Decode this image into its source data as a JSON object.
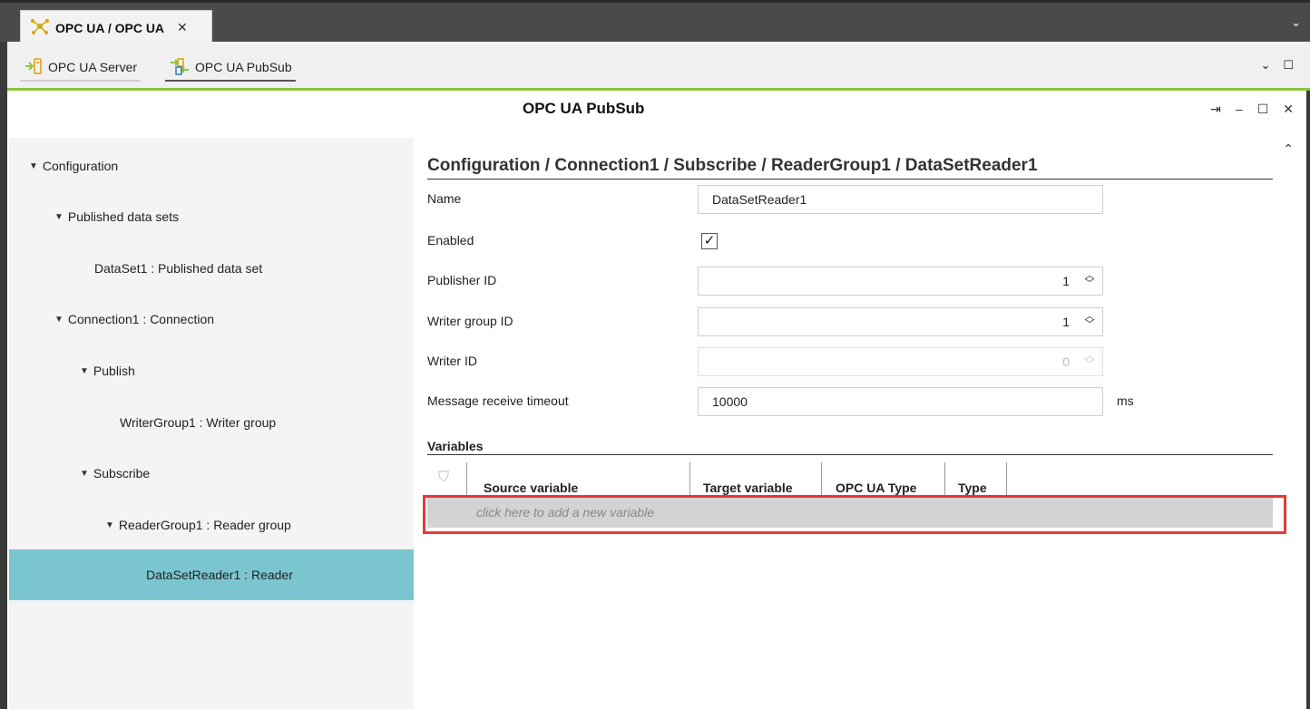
{
  "tab": {
    "label": "OPC UA / OPC UA",
    "close": "✕"
  },
  "tabbar": {
    "menu_glyph": "⌄"
  },
  "perspectives": [
    {
      "label": "OPC UA Server"
    },
    {
      "label": "OPC UA PubSub"
    }
  ],
  "perspective_controls": {
    "minimize": "⌄",
    "maximize": "☐"
  },
  "editor": {
    "title": "OPC UA PubSub",
    "controls": {
      "pin": "⇥",
      "minimize": "–",
      "maximize": "☐",
      "close": "✕"
    }
  },
  "tree": {
    "items": [
      {
        "label": "Configuration",
        "expanded": true
      },
      {
        "label": "Published data sets",
        "expanded": true
      },
      {
        "label": "DataSet1 : Published data set"
      },
      {
        "label": "Connection1 : Connection",
        "expanded": true
      },
      {
        "label": "Publish",
        "expanded": true
      },
      {
        "label": "WriterGroup1 : Writer group"
      },
      {
        "label": "Subscribe",
        "expanded": true
      },
      {
        "label": "ReaderGroup1 : Reader group",
        "expanded": true
      },
      {
        "label": "DataSetReader1 : Reader",
        "selected": true
      }
    ]
  },
  "detail": {
    "collapse_glyph": "⌃",
    "breadcrumb": "Configuration / Connection1 / Subscribe / ReaderGroup1 / DataSetReader1",
    "fields": {
      "name": {
        "label": "Name",
        "value": "DataSetReader1"
      },
      "enabled": {
        "label": "Enabled",
        "checked": true,
        "mark": "✓"
      },
      "publisher_id": {
        "label": "Publisher ID",
        "value": "1"
      },
      "writer_group_id": {
        "label": "Writer group ID",
        "value": "1"
      },
      "writer_id": {
        "label": "Writer ID",
        "value": "0",
        "disabled": true
      },
      "message_timeout": {
        "label": "Message receive timeout",
        "value": "10000",
        "unit": "ms"
      }
    },
    "variables": {
      "label": "Variables",
      "columns": [
        "Source variable",
        "Target variable",
        "OPC UA Type",
        "Type"
      ],
      "add_placeholder": "click here to add a new variable"
    }
  },
  "colors": {
    "accent_green": "#8cc63f",
    "selection": "#7ac5d0",
    "highlight_red": "#e53935"
  }
}
